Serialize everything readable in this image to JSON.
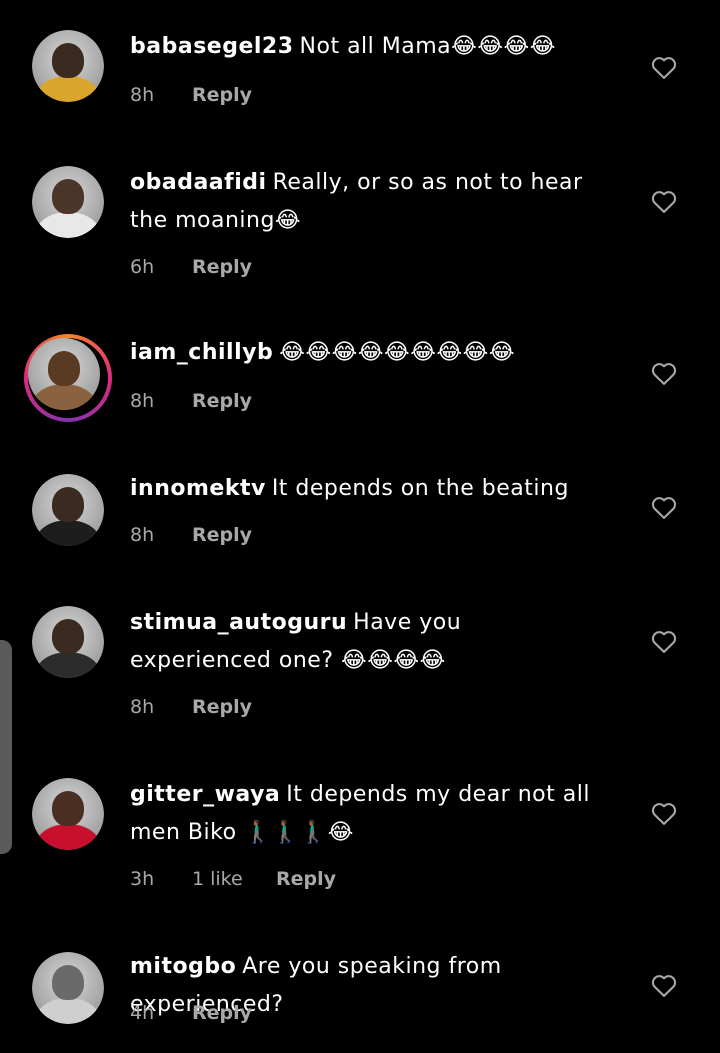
{
  "colors": {
    "background": "#000000",
    "text": "#ffffff",
    "meta": "#a8a8a8",
    "story_ring": "#dd2a7b"
  },
  "icons": {
    "like": "heart-outline-icon"
  },
  "comments": [
    {
      "username": "babasegel23",
      "text": "Not all Mama😂😂😂😂",
      "time": "8h",
      "likes": "",
      "reply": "Reply",
      "avatar_colors": [
        "#3a2a20",
        "#d9a52a"
      ]
    },
    {
      "username": "obadaafidi",
      "text": "Really, or so as not to hear the moaning😂",
      "time": "6h",
      "likes": "",
      "reply": "Reply",
      "avatar_colors": [
        "#4a3528",
        "#e8e8e8"
      ]
    },
    {
      "username": "iam_chillyb",
      "text": "😂😂😂😂😂😂😂😂😂",
      "time": "8h",
      "likes": "",
      "reply": "Reply",
      "avatar_colors": [
        "#5a3a22",
        "#8b6240"
      ],
      "has_story": true
    },
    {
      "username": "innomektv",
      "text": "It depends on the beating",
      "time": "8h",
      "likes": "",
      "reply": "Reply",
      "avatar_colors": [
        "#3b2a1f",
        "#1d1d1d"
      ]
    },
    {
      "username": "stimua_autoguru",
      "text": "Have you experienced one? 😂😂😂😂",
      "time": "8h",
      "likes": "",
      "reply": "Reply",
      "avatar_colors": [
        "#3a2a20",
        "#2c2c2c"
      ]
    },
    {
      "username": "gitter_waya",
      "text": "It depends my dear not all men Biko 🚶🏾‍♂️🚶🏾‍♂️🚶🏾‍♂️😂",
      "time": "3h",
      "likes": "1 like",
      "reply": "Reply",
      "avatar_colors": [
        "#4a2e22",
        "#c8102e"
      ]
    },
    {
      "username": "mitogbo",
      "text": "Are you speaking from experienced?",
      "time": "4h",
      "likes": "",
      "reply": "Reply",
      "avatar_colors": [
        "#6a6a6a",
        "#cfcfcf"
      ]
    }
  ]
}
